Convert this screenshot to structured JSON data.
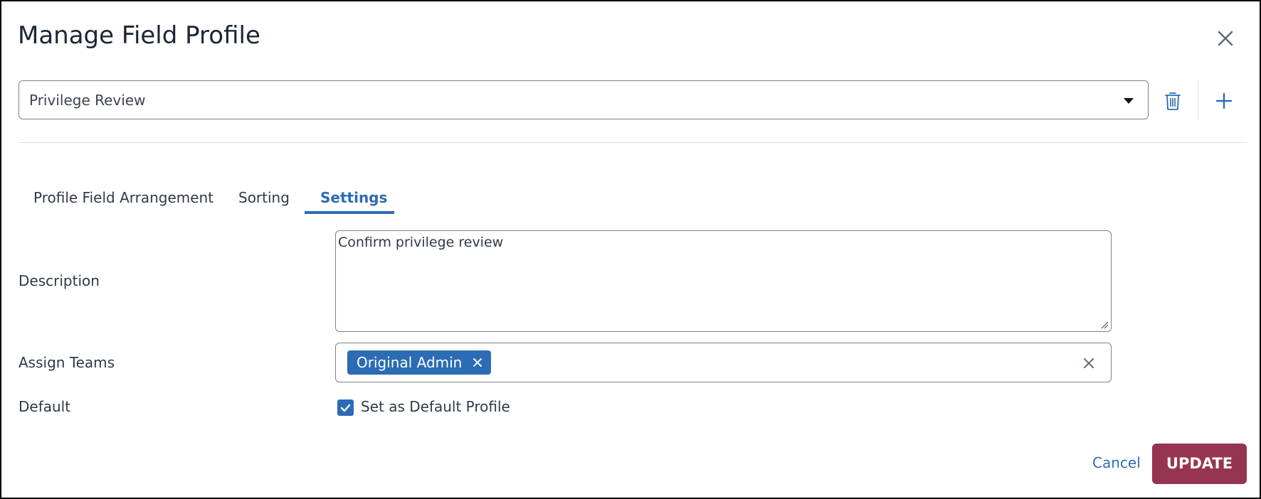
{
  "dialog": {
    "title": "Manage Field Profile",
    "close_icon": "close-icon"
  },
  "profile_select": {
    "value": "Privilege Review",
    "caret_icon": "caret-down-icon",
    "delete_icon": "trash-icon",
    "add_icon": "plus-icon"
  },
  "tabs": [
    {
      "label": "Profile Field Arrangement",
      "active": false
    },
    {
      "label": "Sorting",
      "active": false
    },
    {
      "label": "Settings",
      "active": true
    }
  ],
  "settings": {
    "description_label": "Description",
    "description_value": "Confirm privilege review",
    "assign_teams_label": "Assign Teams",
    "teams": [
      {
        "label": "Original Admin"
      }
    ],
    "default_label": "Default",
    "default_checkbox_label": "Set as Default Profile",
    "default_checked": true
  },
  "footer": {
    "cancel_label": "Cancel",
    "update_label": "UPDATE"
  },
  "colors": {
    "accent": "#2b6cb5",
    "primary_button": "#963552",
    "title_text": "#1b2636",
    "border": "#7d838b"
  }
}
